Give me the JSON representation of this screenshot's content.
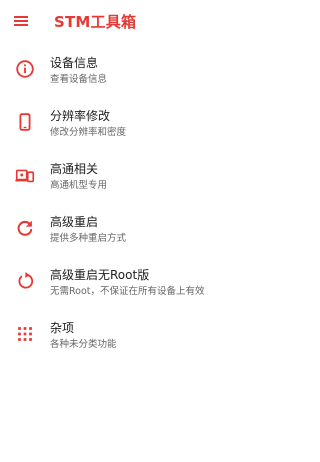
{
  "app": {
    "title": "STM工具箱",
    "accent_color": "#e53935"
  },
  "toolbar": {
    "menu_icon": "hamburger-menu-icon"
  },
  "menu": {
    "items": [
      {
        "label": "设备信息",
        "subtitle": "查看设备信息",
        "icon": "info-icon"
      },
      {
        "label": "分辨率修改",
        "subtitle": "修改分辨率和密度",
        "icon": "phone-icon"
      },
      {
        "label": "高通相关",
        "subtitle": "高通机型专用",
        "icon": "devices-icon"
      },
      {
        "label": "高级重启",
        "subtitle": "提供多种重启方式",
        "icon": "refresh-icon"
      },
      {
        "label": "高级重启无Root版",
        "subtitle": "无需Root，不保证在所有设备上有效",
        "icon": "restart-icon"
      },
      {
        "label": "杂项",
        "subtitle": "各种未分类功能",
        "icon": "apps-grid-icon"
      }
    ]
  }
}
